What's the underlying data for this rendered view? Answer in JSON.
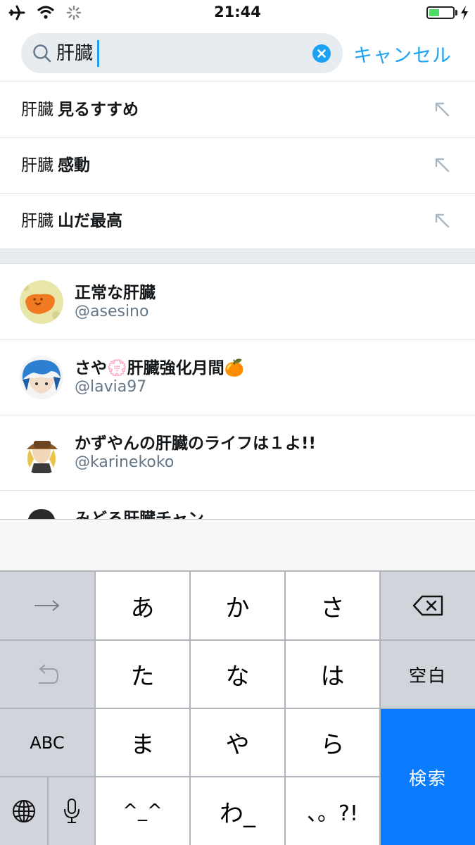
{
  "status_bar": {
    "time": "21:44",
    "battery_level": 0.45
  },
  "search": {
    "query": "肝臓",
    "cancel_label": "キャンセル"
  },
  "suggestions": [
    {
      "prefix": "肝臓",
      "bold": "見るすすめ"
    },
    {
      "prefix": "肝臓",
      "bold": "感動"
    },
    {
      "prefix": "肝臓",
      "bold": "山だ最高"
    }
  ],
  "users": [
    {
      "name": "正常な肝臓",
      "handle": "@asesino"
    },
    {
      "name": "さや💮肝臓強化月間🍊",
      "handle": "@lavia97"
    },
    {
      "name": "かずやんの肝臓のライフは１よ!!",
      "handle": "@karinekoko"
    },
    {
      "name": "みどろ肝臓チャン",
      "handle": ""
    }
  ],
  "keyboard": {
    "row1": [
      "あ",
      "か",
      "さ"
    ],
    "row2": [
      "た",
      "な",
      "は"
    ],
    "row3": [
      "ま",
      "や",
      "ら"
    ],
    "row4": [
      "^_^",
      "わ_",
      "、。?!"
    ],
    "space_label": "空白",
    "abc_label": "ABC",
    "search_label": "検索"
  },
  "colors": {
    "accent": "#1da1f2",
    "keyboard_action": "#0a7bff"
  }
}
